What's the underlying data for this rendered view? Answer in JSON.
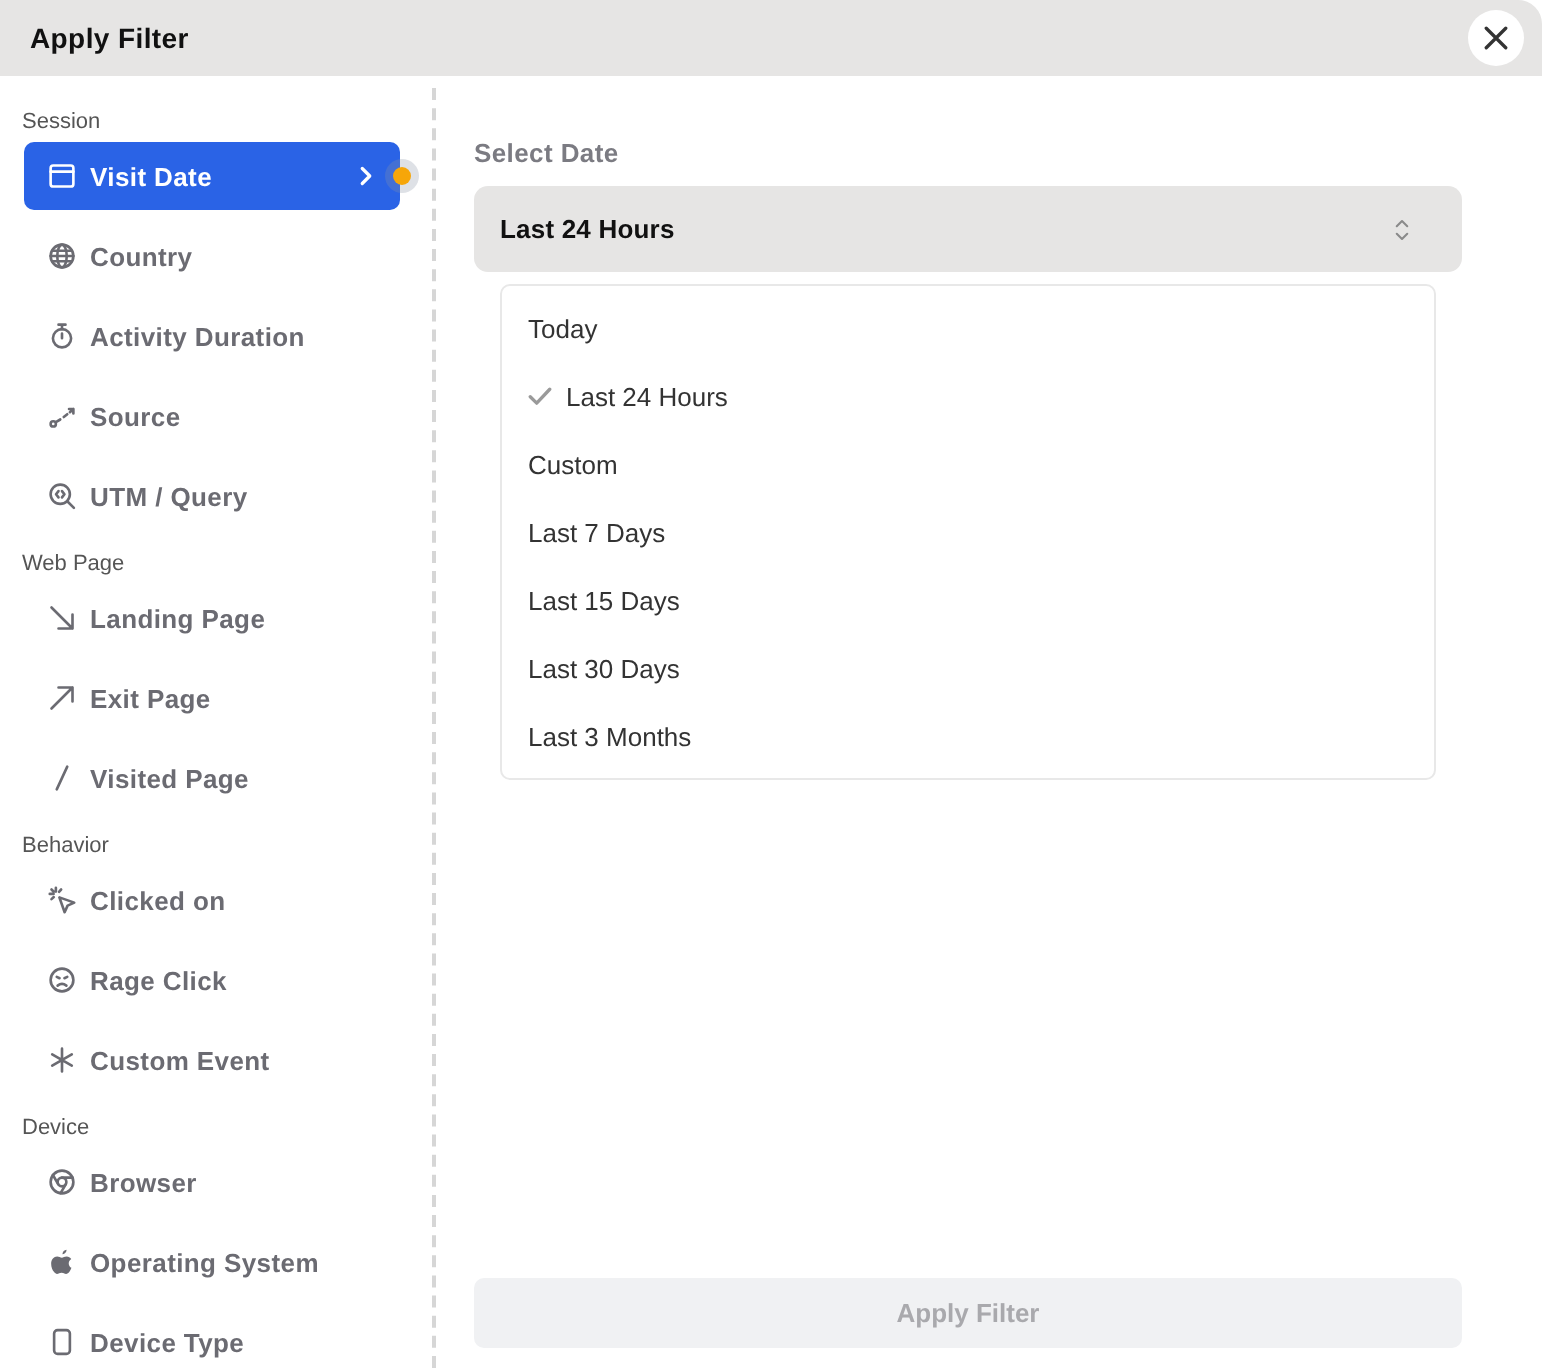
{
  "dialog": {
    "title": "Apply Filter"
  },
  "sidebar": {
    "groups": [
      {
        "label": "Session",
        "items": [
          {
            "label": "Visit Date",
            "selected": true,
            "indicator": true
          },
          {
            "label": "Country",
            "selected": false,
            "indicator": false
          },
          {
            "label": "Activity Duration",
            "selected": false,
            "indicator": false
          },
          {
            "label": "Source",
            "selected": false,
            "indicator": false
          },
          {
            "label": "UTM / Query",
            "selected": false,
            "indicator": false
          }
        ]
      },
      {
        "label": "Web Page",
        "items": [
          {
            "label": "Landing Page",
            "selected": false,
            "indicator": false
          },
          {
            "label": "Exit Page",
            "selected": false,
            "indicator": false
          },
          {
            "label": "Visited Page",
            "selected": false,
            "indicator": false
          }
        ]
      },
      {
        "label": "Behavior",
        "items": [
          {
            "label": "Clicked on",
            "selected": false,
            "indicator": false
          },
          {
            "label": "Rage Click",
            "selected": false,
            "indicator": false
          },
          {
            "label": "Custom Event",
            "selected": false,
            "indicator": false
          }
        ]
      },
      {
        "label": "Device",
        "items": [
          {
            "label": "Browser",
            "selected": false,
            "indicator": false
          },
          {
            "label": "Operating System",
            "selected": false,
            "indicator": false
          },
          {
            "label": "Device Type",
            "selected": false,
            "indicator": false
          }
        ]
      }
    ]
  },
  "date_filter": {
    "label": "Select Date",
    "value": "Last 24 Hours",
    "expanded": true,
    "options": [
      {
        "label": "Today",
        "selected": false
      },
      {
        "label": "Last 24 Hours",
        "selected": true
      },
      {
        "label": "Custom",
        "selected": false
      },
      {
        "label": "Last 7 Days",
        "selected": false
      },
      {
        "label": "Last 15 Days",
        "selected": false
      },
      {
        "label": "Last 30 Days",
        "selected": false
      },
      {
        "label": "Last 3 Months",
        "selected": false
      }
    ]
  },
  "apply_button": {
    "label": "Apply Filter",
    "disabled": true
  }
}
